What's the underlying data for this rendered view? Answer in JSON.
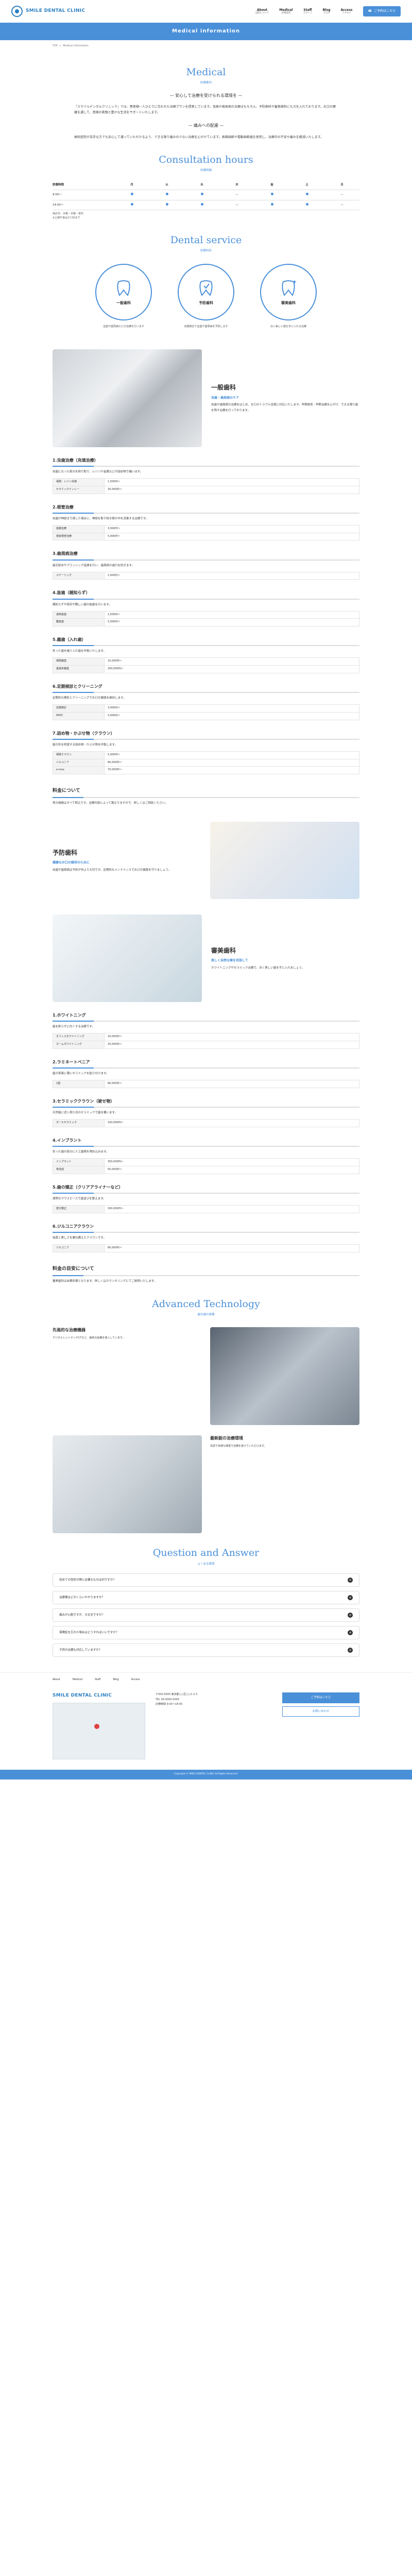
{
  "header": {
    "logo_sub": "SMILE DENTAL CLINIC",
    "logo_main": "SMILE DENTAL CLINIC",
    "nav": [
      {
        "en": "About",
        "jp": "当院について"
      },
      {
        "en": "Medical",
        "jp": "診療案内"
      },
      {
        "en": "Staff",
        "jp": "スタッフ"
      },
      {
        "en": "Blog",
        "jp": "ブログ"
      },
      {
        "en": "Access",
        "jp": "アクセス"
      }
    ],
    "reserve_label": "ご予約はこちら"
  },
  "hero": {
    "title": "Medical information"
  },
  "breadcrumb": [
    "TOP",
    ">",
    "Medical information"
  ],
  "intro": {
    "title": "Medical",
    "sub": "診療案内",
    "heading1": "— 安心して治療を受けられる環境を —",
    "para1": "「スマイルデンタルクリニック」では、患者様一人ひとりに合わせた治療プランを提案しています。虫歯や歯周病の治療はもちろん、予防歯科や審美歯科にも力を入れております。お口の健康を通して、皆様の笑顔と豊かな生活をサポートいたします。",
    "heading2": "— 痛みへの配慮 —",
    "para2": "歯科医院が苦手な方でも安心して通っていただけるよう、できる限り痛みの少ない治療を心がけています。表面麻酔や電動麻酔器を使用し、治療中の不安や痛みを軽減いたします。"
  },
  "hours": {
    "title": "Consultation hours",
    "sub": "診療時間",
    "headers": [
      "診療時間",
      "月",
      "火",
      "水",
      "木",
      "金",
      "土",
      "日"
    ],
    "rows": [
      {
        "label": "9:00～",
        "marks": [
          true,
          true,
          true,
          false,
          true,
          true,
          false
        ]
      },
      {
        "label": "14:00～",
        "marks": [
          true,
          true,
          true,
          false,
          true,
          true,
          false
        ]
      }
    ],
    "notes": [
      "休診日：木曜・日曜・祝日",
      "※土曜午後は17:00まで"
    ]
  },
  "service": {
    "title": "Dental service",
    "sub": "診療科目",
    "cats": [
      {
        "label": "一般歯科",
        "desc": "虫歯や歯周病などの治療を行います"
      },
      {
        "label": "予防歯科",
        "desc": "定期検診で虫歯や歯周病を予防します"
      },
      {
        "label": "審美歯科",
        "desc": "白く美しい歯を手に入れる治療"
      }
    ]
  },
  "general": {
    "title": "一般歯科",
    "sub": "虫歯・歯周病のケア",
    "body": "虫歯や歯周病の治療をはじめ、お口のトラブル全般に対応いたします。早期発見・早期治療を心がけ、できる限り歯を残す治療を行っております。",
    "items": [
      {
        "title": "1.虫歯治療（充填治療）",
        "body": "虫歯になった部分を削り取り、レジンや金属などの詰め物で補います。",
        "rows": [
          [
            "保険：レジン充填",
            "1,500円～"
          ],
          [
            "セラミックインレー",
            "30,000円～"
          ]
        ]
      },
      {
        "title": "2.根管治療",
        "body": "虫歯が神経まで達した場合に、神経を取り除き根の中を消毒する治療です。",
        "rows": [
          [
            "抜髄治療",
            "3,000円～"
          ],
          [
            "感染根管治療",
            "5,000円～"
          ]
        ]
      },
      {
        "title": "3.歯周病治療",
        "body": "歯石除去やブラッシング指導を行い、歯周病の進行を防ぎます。",
        "rows": [
          [
            "スケーリング",
            "2,000円～"
          ]
        ]
      },
      {
        "title": "4.抜歯（親知らず）",
        "body": "親知らずや保存が難しい歯の抜歯を行います。",
        "rows": [
          [
            "通常抜歯",
            "1,500円～"
          ],
          [
            "難抜歯",
            "5,000円～"
          ]
        ]
      },
      {
        "title": "5.義歯（入れ歯）",
        "body": "失った歯を補う入れ歯を作製いたします。",
        "rows": [
          [
            "保険義歯",
            "10,000円～"
          ],
          [
            "金属床義歯",
            "200,000円～"
          ]
        ]
      },
      {
        "title": "6.定期検診とクリーニング",
        "body": "定期的な検診とクリーニングでお口の健康を維持します。",
        "rows": [
          [
            "定期検診",
            "3,000円～"
          ],
          [
            "PMTC",
            "5,000円～"
          ]
        ]
      },
      {
        "title": "7.詰め物・かぶせ物（クラウン）",
        "body": "歯の形を修復する詰め物・かぶせ物を作製します。",
        "rows": [
          [
            "保険クラウン",
            "5,000円～"
          ],
          [
            "ジルコニア",
            "80,000円～"
          ],
          [
            "e-max",
            "70,000円～"
          ]
        ]
      }
    ],
    "fee_title": "料金について",
    "fee_body": "表示価格はすべて税込です。治療内容によって異なりますので、詳しくはご相談ください。"
  },
  "prevent": {
    "title": "予防歯科",
    "sub": "健康なお口の維持のために",
    "body": "虫歯や歯周病は予防が何より大切です。定期的なメンテナンスでお口の健康を守りましょう。"
  },
  "aesthetic": {
    "title": "審美歯科",
    "sub": "美しく自然な歯を目指して",
    "body": "ホワイトニングやセラミック治療で、白く美しい歯を手に入れましょう。",
    "items": [
      {
        "title": "1.ホワイトニング",
        "body": "歯を削らずに白くする治療です。",
        "rows": [
          [
            "オフィスホワイトニング",
            "20,000円～"
          ],
          [
            "ホームホワイトニング",
            "25,000円～"
          ]
        ]
      },
      {
        "title": "2.ラミネートベニア",
        "body": "歯の表面に薄いセラミックを貼り付けます。",
        "rows": [
          [
            "1歯",
            "80,000円～"
          ]
        ]
      },
      {
        "title": "3.セラミッククラウン（被せ物）",
        "body": "天然歯に近い見た目のセラミックで歯を覆います。",
        "rows": [
          [
            "オールセラミック",
            "100,000円～"
          ]
        ]
      },
      {
        "title": "4.インプラント",
        "body": "失った歯の部分に人工歯根を埋め込みます。",
        "rows": [
          [
            "インプラント",
            "350,000円～"
          ],
          [
            "骨造成",
            "50,000円～"
          ]
        ]
      },
      {
        "title": "5.歯の矯正（クリアアライナーなど）",
        "body": "透明なマウスピースで歯並びを整えます。",
        "rows": [
          [
            "部分矯正",
            "300,000円～"
          ]
        ]
      },
      {
        "title": "6.ジルコニアクラウン",
        "body": "強度と美しさを兼ね備えたクラウンです。",
        "rows": [
          [
            "ジルコニア",
            "80,000円～"
          ]
        ]
      }
    ],
    "fee_title": "料金の目安について",
    "fee_body": "審美歯科は自費診療となります。詳しくはカウンセリングにてご説明いたします。"
  },
  "tech": {
    "title": "Advanced Technology",
    "sub": "最先端の設備",
    "items": [
      {
        "title": "先進的な治療機器",
        "body": "デジタルレントゲンやCTなど、最新の設備を導入しています。"
      },
      {
        "title": "最新鋭の治療環境",
        "body": "清潔で快適な環境で治療を受けていただけます。"
      }
    ]
  },
  "faq": {
    "title": "Question and Answer",
    "sub": "よくある質問",
    "items": [
      "初めての受診の際に必要なものは何ですか？",
      "治療費はどのくらいかかりますか？",
      "痛みが心配ですが、大丈夫ですか？",
      "保険証を忘れた場合はどうすればいいですか？",
      "子供の治療も対応していますか？"
    ]
  },
  "footer": {
    "nav": [
      "About",
      "Medical",
      "Staff",
      "Blog",
      "Access"
    ],
    "name": "SMILE DENTAL CLINIC",
    "address": "〒000-0000 東京都○○区○○1-2-3",
    "tel": "TEL 00-0000-0000",
    "hours": "診療時間 9:00～18:00",
    "btn1": "ご予約はこちら",
    "btn2": "お問い合わせ",
    "copyright": "Copyright © SMILE DENTAL CLINIC All Rights Reserved."
  }
}
